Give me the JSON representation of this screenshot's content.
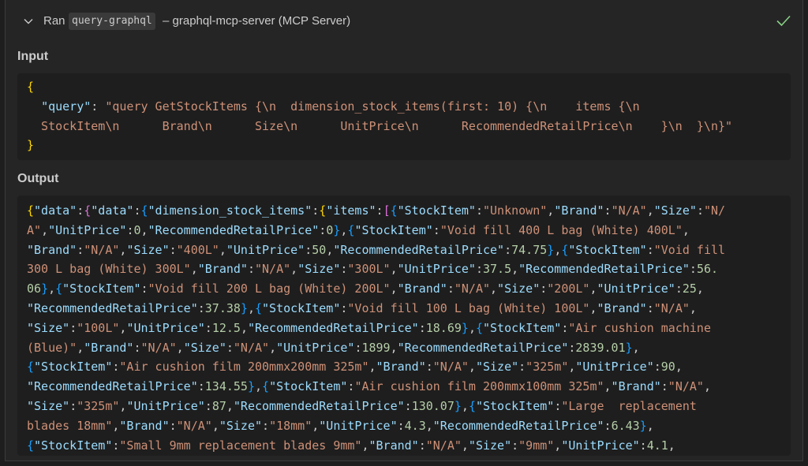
{
  "header": {
    "ran_label": "Ran",
    "tool_name": "query-graphql",
    "server_label": "– graphql-mcp-server (MCP Server)",
    "expand_icon": "chevron-down-icon",
    "status_icon": "checkmark-icon",
    "status_color": "#89d185"
  },
  "input": {
    "label": "Input",
    "lines": [
      [
        {
          "t": "{",
          "c": "br"
        }
      ],
      [
        {
          "t": "  ",
          "c": "punc"
        },
        {
          "t": "\"query\"",
          "c": "key"
        },
        {
          "t": ": ",
          "c": "punc"
        },
        {
          "t": "\"query GetStockItems {\\n  dimension_stock_items(first: 10) {\\n    items {\\n",
          "c": "str"
        }
      ],
      [
        {
          "t": "  StockItem\\n      Brand\\n      Size\\n      UnitPrice\\n      RecommendedRetailPrice\\n    }\\n  }\\n}\"",
          "c": "str"
        }
      ],
      [
        {
          "t": "}",
          "c": "br"
        }
      ]
    ]
  },
  "output": {
    "label": "Output",
    "lines": [
      [
        {
          "t": "{",
          "c": "br"
        },
        {
          "t": "\"data\"",
          "c": "key"
        },
        {
          "t": ":",
          "c": "punc"
        },
        {
          "t": "{",
          "c": "br2"
        },
        {
          "t": "\"data\"",
          "c": "key"
        },
        {
          "t": ":",
          "c": "punc"
        },
        {
          "t": "{",
          "c": "br3"
        },
        {
          "t": "\"dimension_stock_items\"",
          "c": "key"
        },
        {
          "t": ":",
          "c": "punc"
        },
        {
          "t": "{",
          "c": "br"
        },
        {
          "t": "\"items\"",
          "c": "key"
        },
        {
          "t": ":",
          "c": "punc"
        },
        {
          "t": "[",
          "c": "br2"
        },
        {
          "t": "{",
          "c": "br3"
        },
        {
          "t": "\"StockItem\"",
          "c": "key"
        },
        {
          "t": ":",
          "c": "punc"
        },
        {
          "t": "\"Unknown\"",
          "c": "str"
        },
        {
          "t": ",",
          "c": "punc"
        },
        {
          "t": "\"Brand\"",
          "c": "key"
        },
        {
          "t": ":",
          "c": "punc"
        },
        {
          "t": "\"N/A\"",
          "c": "str"
        },
        {
          "t": ",",
          "c": "punc"
        },
        {
          "t": "\"Size\"",
          "c": "key"
        },
        {
          "t": ":",
          "c": "punc"
        },
        {
          "t": "\"N/",
          "c": "str"
        }
      ],
      [
        {
          "t": "A\"",
          "c": "str"
        },
        {
          "t": ",",
          "c": "punc"
        },
        {
          "t": "\"UnitPrice\"",
          "c": "key"
        },
        {
          "t": ":",
          "c": "punc"
        },
        {
          "t": "0",
          "c": "num"
        },
        {
          "t": ",",
          "c": "punc"
        },
        {
          "t": "\"RecommendedRetailPrice\"",
          "c": "key"
        },
        {
          "t": ":",
          "c": "punc"
        },
        {
          "t": "0",
          "c": "num"
        },
        {
          "t": "}",
          "c": "br3"
        },
        {
          "t": ",",
          "c": "punc"
        },
        {
          "t": "{",
          "c": "br3"
        },
        {
          "t": "\"StockItem\"",
          "c": "key"
        },
        {
          "t": ":",
          "c": "punc"
        },
        {
          "t": "\"Void fill 400 L bag (White) 400L\"",
          "c": "str"
        },
        {
          "t": ",",
          "c": "punc"
        }
      ],
      [
        {
          "t": "\"Brand\"",
          "c": "key"
        },
        {
          "t": ":",
          "c": "punc"
        },
        {
          "t": "\"N/A\"",
          "c": "str"
        },
        {
          "t": ",",
          "c": "punc"
        },
        {
          "t": "\"Size\"",
          "c": "key"
        },
        {
          "t": ":",
          "c": "punc"
        },
        {
          "t": "\"400L\"",
          "c": "str"
        },
        {
          "t": ",",
          "c": "punc"
        },
        {
          "t": "\"UnitPrice\"",
          "c": "key"
        },
        {
          "t": ":",
          "c": "punc"
        },
        {
          "t": "50",
          "c": "num"
        },
        {
          "t": ",",
          "c": "punc"
        },
        {
          "t": "\"RecommendedRetailPrice\"",
          "c": "key"
        },
        {
          "t": ":",
          "c": "punc"
        },
        {
          "t": "74.75",
          "c": "num"
        },
        {
          "t": "}",
          "c": "br3"
        },
        {
          "t": ",",
          "c": "punc"
        },
        {
          "t": "{",
          "c": "br3"
        },
        {
          "t": "\"StockItem\"",
          "c": "key"
        },
        {
          "t": ":",
          "c": "punc"
        },
        {
          "t": "\"Void fill",
          "c": "str"
        }
      ],
      [
        {
          "t": "300 L bag (White) 300L\"",
          "c": "str"
        },
        {
          "t": ",",
          "c": "punc"
        },
        {
          "t": "\"Brand\"",
          "c": "key"
        },
        {
          "t": ":",
          "c": "punc"
        },
        {
          "t": "\"N/A\"",
          "c": "str"
        },
        {
          "t": ",",
          "c": "punc"
        },
        {
          "t": "\"Size\"",
          "c": "key"
        },
        {
          "t": ":",
          "c": "punc"
        },
        {
          "t": "\"300L\"",
          "c": "str"
        },
        {
          "t": ",",
          "c": "punc"
        },
        {
          "t": "\"UnitPrice\"",
          "c": "key"
        },
        {
          "t": ":",
          "c": "punc"
        },
        {
          "t": "37.5",
          "c": "num"
        },
        {
          "t": ",",
          "c": "punc"
        },
        {
          "t": "\"RecommendedRetailPrice\"",
          "c": "key"
        },
        {
          "t": ":",
          "c": "punc"
        },
        {
          "t": "56.",
          "c": "num"
        }
      ],
      [
        {
          "t": "06",
          "c": "num"
        },
        {
          "t": "}",
          "c": "br3"
        },
        {
          "t": ",",
          "c": "punc"
        },
        {
          "t": "{",
          "c": "br3"
        },
        {
          "t": "\"StockItem\"",
          "c": "key"
        },
        {
          "t": ":",
          "c": "punc"
        },
        {
          "t": "\"Void fill 200 L bag (White) 200L\"",
          "c": "str"
        },
        {
          "t": ",",
          "c": "punc"
        },
        {
          "t": "\"Brand\"",
          "c": "key"
        },
        {
          "t": ":",
          "c": "punc"
        },
        {
          "t": "\"N/A\"",
          "c": "str"
        },
        {
          "t": ",",
          "c": "punc"
        },
        {
          "t": "\"Size\"",
          "c": "key"
        },
        {
          "t": ":",
          "c": "punc"
        },
        {
          "t": "\"200L\"",
          "c": "str"
        },
        {
          "t": ",",
          "c": "punc"
        },
        {
          "t": "\"UnitPrice\"",
          "c": "key"
        },
        {
          "t": ":",
          "c": "punc"
        },
        {
          "t": "25",
          "c": "num"
        },
        {
          "t": ",",
          "c": "punc"
        }
      ],
      [
        {
          "t": "\"RecommendedRetailPrice\"",
          "c": "key"
        },
        {
          "t": ":",
          "c": "punc"
        },
        {
          "t": "37.38",
          "c": "num"
        },
        {
          "t": "}",
          "c": "br3"
        },
        {
          "t": ",",
          "c": "punc"
        },
        {
          "t": "{",
          "c": "br3"
        },
        {
          "t": "\"StockItem\"",
          "c": "key"
        },
        {
          "t": ":",
          "c": "punc"
        },
        {
          "t": "\"Void fill 100 L bag (White) 100L\"",
          "c": "str"
        },
        {
          "t": ",",
          "c": "punc"
        },
        {
          "t": "\"Brand\"",
          "c": "key"
        },
        {
          "t": ":",
          "c": "punc"
        },
        {
          "t": "\"N/A\"",
          "c": "str"
        },
        {
          "t": ",",
          "c": "punc"
        }
      ],
      [
        {
          "t": "\"Size\"",
          "c": "key"
        },
        {
          "t": ":",
          "c": "punc"
        },
        {
          "t": "\"100L\"",
          "c": "str"
        },
        {
          "t": ",",
          "c": "punc"
        },
        {
          "t": "\"UnitPrice\"",
          "c": "key"
        },
        {
          "t": ":",
          "c": "punc"
        },
        {
          "t": "12.5",
          "c": "num"
        },
        {
          "t": ",",
          "c": "punc"
        },
        {
          "t": "\"RecommendedRetailPrice\"",
          "c": "key"
        },
        {
          "t": ":",
          "c": "punc"
        },
        {
          "t": "18.69",
          "c": "num"
        },
        {
          "t": "}",
          "c": "br3"
        },
        {
          "t": ",",
          "c": "punc"
        },
        {
          "t": "{",
          "c": "br3"
        },
        {
          "t": "\"StockItem\"",
          "c": "key"
        },
        {
          "t": ":",
          "c": "punc"
        },
        {
          "t": "\"Air cushion machine",
          "c": "str"
        }
      ],
      [
        {
          "t": "(Blue)\"",
          "c": "str"
        },
        {
          "t": ",",
          "c": "punc"
        },
        {
          "t": "\"Brand\"",
          "c": "key"
        },
        {
          "t": ":",
          "c": "punc"
        },
        {
          "t": "\"N/A\"",
          "c": "str"
        },
        {
          "t": ",",
          "c": "punc"
        },
        {
          "t": "\"Size\"",
          "c": "key"
        },
        {
          "t": ":",
          "c": "punc"
        },
        {
          "t": "\"N/A\"",
          "c": "str"
        },
        {
          "t": ",",
          "c": "punc"
        },
        {
          "t": "\"UnitPrice\"",
          "c": "key"
        },
        {
          "t": ":",
          "c": "punc"
        },
        {
          "t": "1899",
          "c": "num"
        },
        {
          "t": ",",
          "c": "punc"
        },
        {
          "t": "\"RecommendedRetailPrice\"",
          "c": "key"
        },
        {
          "t": ":",
          "c": "punc"
        },
        {
          "t": "2839.01",
          "c": "num"
        },
        {
          "t": "}",
          "c": "br3"
        },
        {
          "t": ",",
          "c": "punc"
        }
      ],
      [
        {
          "t": "{",
          "c": "br3"
        },
        {
          "t": "\"StockItem\"",
          "c": "key"
        },
        {
          "t": ":",
          "c": "punc"
        },
        {
          "t": "\"Air cushion film 200mmx200mm 325m\"",
          "c": "str"
        },
        {
          "t": ",",
          "c": "punc"
        },
        {
          "t": "\"Brand\"",
          "c": "key"
        },
        {
          "t": ":",
          "c": "punc"
        },
        {
          "t": "\"N/A\"",
          "c": "str"
        },
        {
          "t": ",",
          "c": "punc"
        },
        {
          "t": "\"Size\"",
          "c": "key"
        },
        {
          "t": ":",
          "c": "punc"
        },
        {
          "t": "\"325m\"",
          "c": "str"
        },
        {
          "t": ",",
          "c": "punc"
        },
        {
          "t": "\"UnitPrice\"",
          "c": "key"
        },
        {
          "t": ":",
          "c": "punc"
        },
        {
          "t": "90",
          "c": "num"
        },
        {
          "t": ",",
          "c": "punc"
        }
      ],
      [
        {
          "t": "\"RecommendedRetailPrice\"",
          "c": "key"
        },
        {
          "t": ":",
          "c": "punc"
        },
        {
          "t": "134.55",
          "c": "num"
        },
        {
          "t": "}",
          "c": "br3"
        },
        {
          "t": ",",
          "c": "punc"
        },
        {
          "t": "{",
          "c": "br3"
        },
        {
          "t": "\"StockItem\"",
          "c": "key"
        },
        {
          "t": ":",
          "c": "punc"
        },
        {
          "t": "\"Air cushion film 200mmx100mm 325m\"",
          "c": "str"
        },
        {
          "t": ",",
          "c": "punc"
        },
        {
          "t": "\"Brand\"",
          "c": "key"
        },
        {
          "t": ":",
          "c": "punc"
        },
        {
          "t": "\"N/A\"",
          "c": "str"
        },
        {
          "t": ",",
          "c": "punc"
        }
      ],
      [
        {
          "t": "\"Size\"",
          "c": "key"
        },
        {
          "t": ":",
          "c": "punc"
        },
        {
          "t": "\"325m\"",
          "c": "str"
        },
        {
          "t": ",",
          "c": "punc"
        },
        {
          "t": "\"UnitPrice\"",
          "c": "key"
        },
        {
          "t": ":",
          "c": "punc"
        },
        {
          "t": "87",
          "c": "num"
        },
        {
          "t": ",",
          "c": "punc"
        },
        {
          "t": "\"RecommendedRetailPrice\"",
          "c": "key"
        },
        {
          "t": ":",
          "c": "punc"
        },
        {
          "t": "130.07",
          "c": "num"
        },
        {
          "t": "}",
          "c": "br3"
        },
        {
          "t": ",",
          "c": "punc"
        },
        {
          "t": "{",
          "c": "br3"
        },
        {
          "t": "\"StockItem\"",
          "c": "key"
        },
        {
          "t": ":",
          "c": "punc"
        },
        {
          "t": "\"Large  replacement",
          "c": "str"
        }
      ],
      [
        {
          "t": "blades 18mm\"",
          "c": "str"
        },
        {
          "t": ",",
          "c": "punc"
        },
        {
          "t": "\"Brand\"",
          "c": "key"
        },
        {
          "t": ":",
          "c": "punc"
        },
        {
          "t": "\"N/A\"",
          "c": "str"
        },
        {
          "t": ",",
          "c": "punc"
        },
        {
          "t": "\"Size\"",
          "c": "key"
        },
        {
          "t": ":",
          "c": "punc"
        },
        {
          "t": "\"18mm\"",
          "c": "str"
        },
        {
          "t": ",",
          "c": "punc"
        },
        {
          "t": "\"UnitPrice\"",
          "c": "key"
        },
        {
          "t": ":",
          "c": "punc"
        },
        {
          "t": "4.3",
          "c": "num"
        },
        {
          "t": ",",
          "c": "punc"
        },
        {
          "t": "\"RecommendedRetailPrice\"",
          "c": "key"
        },
        {
          "t": ":",
          "c": "punc"
        },
        {
          "t": "6.43",
          "c": "num"
        },
        {
          "t": "}",
          "c": "br3"
        },
        {
          "t": ",",
          "c": "punc"
        }
      ],
      [
        {
          "t": "{",
          "c": "br3"
        },
        {
          "t": "\"StockItem\"",
          "c": "key"
        },
        {
          "t": ":",
          "c": "punc"
        },
        {
          "t": "\"Small 9mm replacement blades 9mm\"",
          "c": "str"
        },
        {
          "t": ",",
          "c": "punc"
        },
        {
          "t": "\"Brand\"",
          "c": "key"
        },
        {
          "t": ":",
          "c": "punc"
        },
        {
          "t": "\"N/A\"",
          "c": "str"
        },
        {
          "t": ",",
          "c": "punc"
        },
        {
          "t": "\"Size\"",
          "c": "key"
        },
        {
          "t": ":",
          "c": "punc"
        },
        {
          "t": "\"9mm\"",
          "c": "str"
        },
        {
          "t": ",",
          "c": "punc"
        },
        {
          "t": "\"UnitPrice\"",
          "c": "key"
        },
        {
          "t": ":",
          "c": "punc"
        },
        {
          "t": "4.1",
          "c": "num"
        },
        {
          "t": ",",
          "c": "punc"
        }
      ]
    ]
  }
}
